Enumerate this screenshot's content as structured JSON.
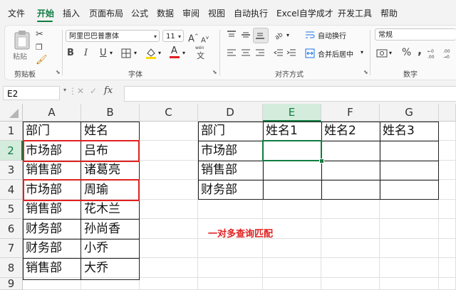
{
  "menu": {
    "items": [
      "文件",
      "开始",
      "插入",
      "页面布局",
      "公式",
      "数据",
      "审阅",
      "视图",
      "自动执行",
      "Excel自学成才",
      "开发工具",
      "帮助"
    ],
    "active": "开始"
  },
  "ribbon": {
    "clipboard": {
      "paste_label": "粘贴",
      "group_label": "剪贴板"
    },
    "font": {
      "font_name": "阿里巴巴普惠体",
      "font_size": "11",
      "group_label": "字体",
      "size_up": "A",
      "size_down": "A",
      "bold": "B",
      "italic": "I",
      "underline": "U",
      "font_color_letter": "A",
      "wen": "wén",
      "wen_char": "文"
    },
    "alignment": {
      "wrap_text": "自动换行",
      "merge_center": "合并后居中",
      "group_label": "对齐方式"
    },
    "number": {
      "format": "常规",
      "group_label": "数字",
      "percent": "%",
      "comma": ","
    }
  },
  "formula_bar": {
    "name_box": "E2",
    "fx": "fx",
    "cancel": "✕",
    "enter": "✓",
    "value": ""
  },
  "columns": [
    "A",
    "B",
    "C",
    "D",
    "E",
    "F",
    "G"
  ],
  "rows": [
    "1",
    "2",
    "3",
    "4",
    "5",
    "6",
    "7",
    "8",
    "9"
  ],
  "cells": {
    "A1": "部门",
    "B1": "姓名",
    "A2": "市场部",
    "B2": "吕布",
    "A3": "销售部",
    "B3": "诸葛亮",
    "A4": "市场部",
    "B4": "周瑜",
    "A5": "销售部",
    "B5": "花木兰",
    "A6": "财务部",
    "B6": "孙尚香",
    "A7": "财务部",
    "B7": "小乔",
    "A8": "销售部",
    "B8": "大乔",
    "D1": "部门",
    "E1": "姓名1",
    "F1": "姓名2",
    "G1": "姓名3",
    "D2": "市场部",
    "D3": "销售部",
    "D4": "财务部"
  },
  "selected_cell": "E2",
  "annotation": "一对多查询匹配",
  "colors": {
    "accent": "#107c41",
    "highlight": "#e02020"
  }
}
